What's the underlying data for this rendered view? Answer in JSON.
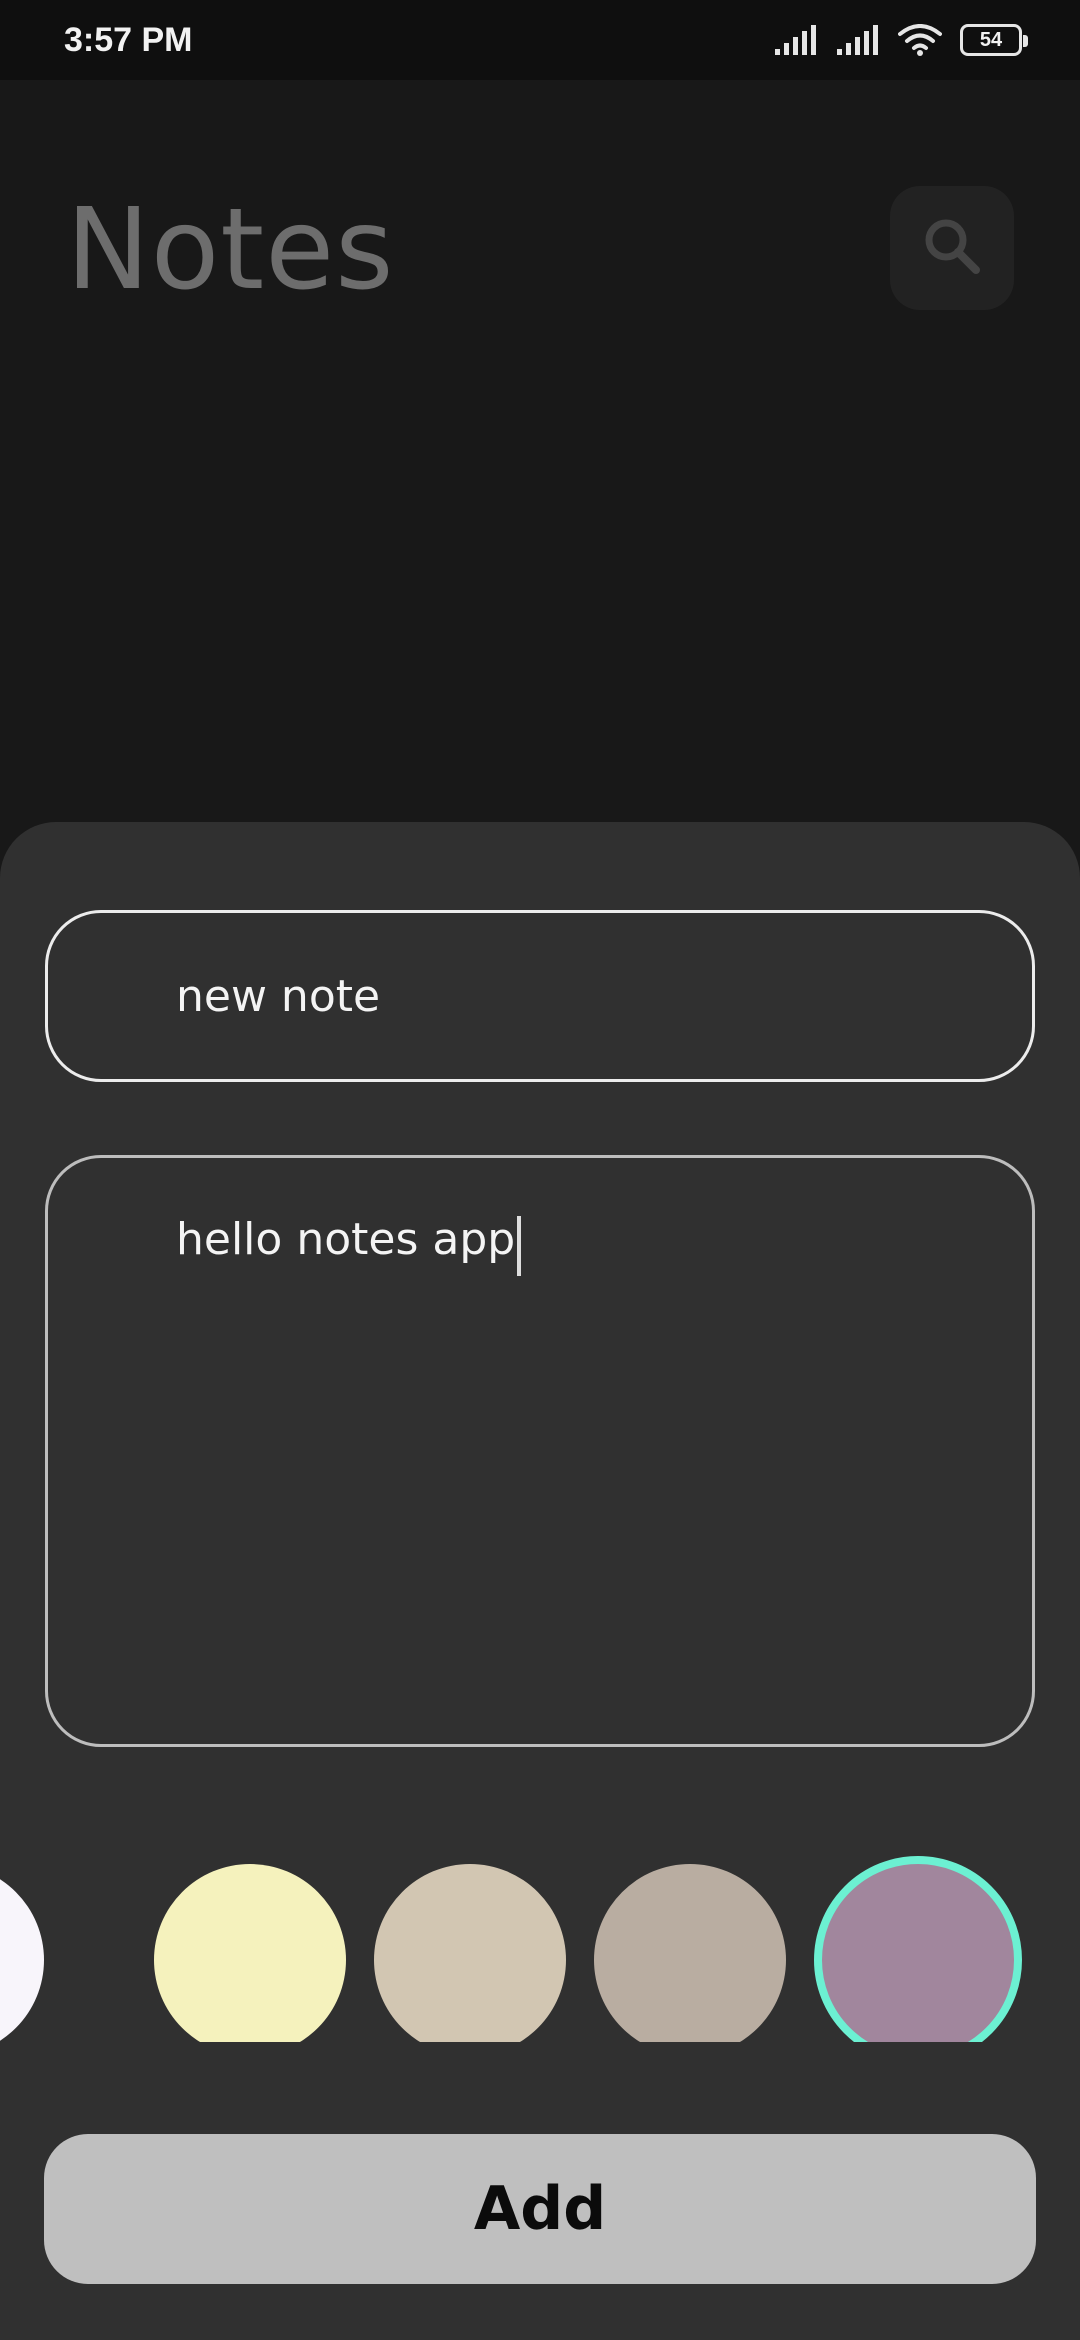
{
  "status_bar": {
    "time": "3:57 PM",
    "battery_level": "54",
    "icons": [
      "signal-icon",
      "signal-icon",
      "wifi-icon",
      "battery-icon"
    ]
  },
  "header": {
    "title": "Notes",
    "search_icon": "search-icon"
  },
  "sheet": {
    "title_value": "new note",
    "body_value": "hello notes app",
    "colors": [
      {
        "hex": "#f8f5fb",
        "selected": false
      },
      {
        "hex": "#f5f2bd",
        "selected": false
      },
      {
        "hex": "#d2c6b2",
        "selected": false
      },
      {
        "hex": "#b9ada1",
        "selected": false
      },
      {
        "hex": "#a1869d",
        "selected": true
      }
    ],
    "selected_ring_color": "#6cf0d2",
    "add_label": "Add"
  },
  "theme": {
    "background": "#181818",
    "sheet_background": "#303030",
    "button_background": "#bfbfbf"
  }
}
